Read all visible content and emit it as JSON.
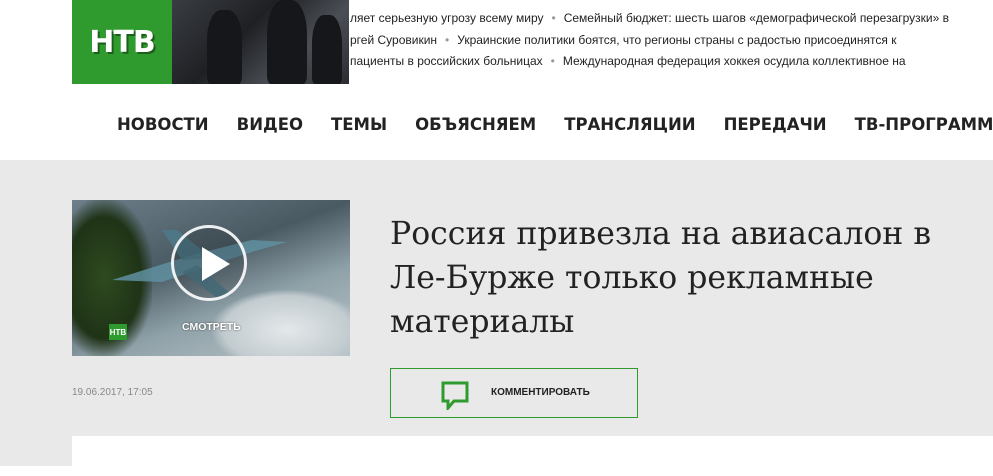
{
  "logo": {
    "text": "НТВ"
  },
  "ticker": {
    "lines": [
      [
        "ляет серьезную угрозу всему миру",
        "Семейный бюджет: шесть шагов «демографической перезагрузки» в"
      ],
      [
        "ргей Суровикин",
        "Украинские политики боятся, что регионы страны с радостью присоединятся к"
      ],
      [
        "пациенты в российских больницах",
        "Международная федерация хоккея осудила коллективное на"
      ]
    ]
  },
  "nav": {
    "items": [
      "НОВОСТИ",
      "ВИДЕО",
      "ТЕМЫ",
      "ОБЪЯСНЯЕМ",
      "ТРАНСЛЯЦИИ",
      "ПЕРЕДАЧИ",
      "ТВ-ПРОГРАММА"
    ]
  },
  "article": {
    "headline": "Россия привезла на авиасалон в Ле-Бурже только рекламные материалы",
    "date": "19.06.2017, 17:05",
    "video_label": "СМОТРЕТЬ",
    "video_logo": "НТВ",
    "comment_label": "КОММЕНТИРОВАТЬ"
  },
  "colors": {
    "brand": "#2f9b2f",
    "background": "#e9e9e9",
    "text": "#222222"
  },
  "icons": [
    "play-icon",
    "comment-icon"
  ]
}
